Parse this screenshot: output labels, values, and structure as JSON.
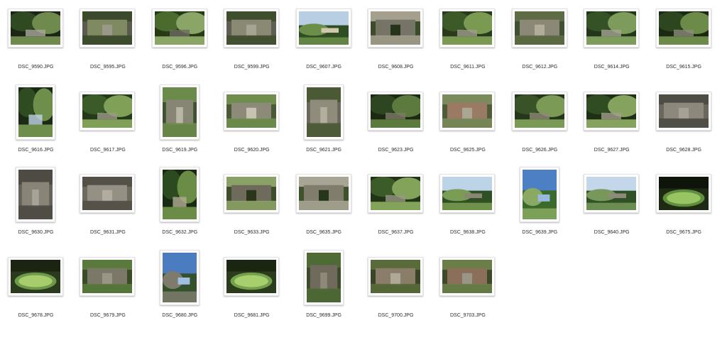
{
  "files": [
    {
      "name": "DSC_9590.JPG",
      "orientation": "landscape",
      "scene": "forest",
      "palette": [
        "#2f4a22",
        "#6e8a4c",
        "#a9a79b",
        "#1c2616"
      ]
    },
    {
      "name": "DSC_9595.JPG",
      "orientation": "landscape",
      "scene": "ruins",
      "palette": [
        "#5a5a50",
        "#7f8a63",
        "#3b4a2a",
        "#9a9888"
      ]
    },
    {
      "name": "DSC_9596.JPG",
      "orientation": "landscape",
      "scene": "forest",
      "palette": [
        "#4a6a2e",
        "#8aa565",
        "#6d6a62",
        "#263a16"
      ]
    },
    {
      "name": "DSC_9599.JPG",
      "orientation": "landscape",
      "scene": "ruins",
      "palette": [
        "#5f5e55",
        "#8a8a74",
        "#3f4e2c",
        "#a7a393"
      ]
    },
    {
      "name": "DSC_9607.JPG",
      "orientation": "landscape",
      "scene": "sky",
      "palette": [
        "#2e4d22",
        "#6b8f49",
        "#b8cfe3",
        "#d0c7ad"
      ]
    },
    {
      "name": "DSC_9608.JPG",
      "orientation": "landscape",
      "scene": "ruins",
      "palette": [
        "#3b4c2b",
        "#767466",
        "#a59f8e",
        "#263519"
      ]
    },
    {
      "name": "DSC_9611.JPG",
      "orientation": "landscape",
      "scene": "forest",
      "palette": [
        "#3c5a28",
        "#7a9a52",
        "#9f9c8c",
        "#2a3a1a"
      ]
    },
    {
      "name": "DSC_9612.JPG",
      "orientation": "landscape",
      "scene": "ruins",
      "palette": [
        "#3f5130",
        "#8b8878",
        "#5e6b45",
        "#b2ad9a"
      ]
    },
    {
      "name": "DSC_9614.JPG",
      "orientation": "landscape",
      "scene": "forest",
      "palette": [
        "#355226",
        "#7d9b5b",
        "#a5a496",
        "#24361a"
      ]
    },
    {
      "name": "DSC_9615.JPG",
      "orientation": "landscape",
      "scene": "forest",
      "palette": [
        "#2e4620",
        "#6c8a48",
        "#8c8a7c",
        "#1b2812"
      ]
    },
    {
      "name": "DSC_9616.JPG",
      "orientation": "portrait",
      "scene": "forest",
      "palette": [
        "#2f4b22",
        "#6d8f4b",
        "#c3d6e6",
        "#1b2a14"
      ]
    },
    {
      "name": "DSC_9617.JPG",
      "orientation": "landscape",
      "scene": "forest",
      "palette": [
        "#3a5a28",
        "#7fa056",
        "#9d9a88",
        "#25381a"
      ]
    },
    {
      "name": "DSC_9619.JPG",
      "orientation": "portrait",
      "scene": "ruins",
      "palette": [
        "#3d5230",
        "#878573",
        "#6b8b4a",
        "#b9b6a6"
      ]
    },
    {
      "name": "DSC_9620.JPG",
      "orientation": "landscape",
      "scene": "ruins",
      "palette": [
        "#4a5a36",
        "#8c8a78",
        "#6f8e4d",
        "#c8c3b0"
      ]
    },
    {
      "name": "DSC_9621.JPG",
      "orientation": "portrait",
      "scene": "ruins",
      "palette": [
        "#6a675c",
        "#8f8c7c",
        "#4b5a34",
        "#b3ae9d"
      ]
    },
    {
      "name": "DSC_9623.JPG",
      "orientation": "landscape",
      "scene": "forest",
      "palette": [
        "#2d4520",
        "#5c7a3d",
        "#807b68",
        "#1c2a13"
      ]
    },
    {
      "name": "DSC_9625.JPG",
      "orientation": "landscape",
      "scene": "ruins",
      "palette": [
        "#4e5d38",
        "#9a7a62",
        "#7a8a5a",
        "#a9a694"
      ]
    },
    {
      "name": "DSC_9626.JPG",
      "orientation": "landscape",
      "scene": "forest",
      "palette": [
        "#3a5228",
        "#7a9a55",
        "#8f8a76",
        "#25361a"
      ]
    },
    {
      "name": "DSC_9627.JPG",
      "orientation": "landscape",
      "scene": "forest",
      "palette": [
        "#2f4c22",
        "#85a35e",
        "#a39e8c",
        "#1f2f15"
      ]
    },
    {
      "name": "DSC_9628.JPG",
      "orientation": "landscape",
      "scene": "ruins",
      "palette": [
        "#6b675e",
        "#8c887c",
        "#4e4d45",
        "#a6a196"
      ]
    },
    {
      "name": "DSC_9630.JPG",
      "orientation": "portrait",
      "scene": "ruins",
      "palette": [
        "#65625a",
        "#888478",
        "#4d4b44",
        "#a7a398"
      ]
    },
    {
      "name": "DSC_9631.JPG",
      "orientation": "landscape",
      "scene": "ruins",
      "palette": [
        "#6e6a60",
        "#949083",
        "#535048",
        "#b1ac9f"
      ]
    },
    {
      "name": "DSC_9632.JPG",
      "orientation": "portrait",
      "scene": "forest",
      "palette": [
        "#2c4a20",
        "#6a8c47",
        "#b3ad92",
        "#1a2a12"
      ]
    },
    {
      "name": "DSC_9633.JPG",
      "orientation": "landscape",
      "scene": "ruins",
      "palette": [
        "#3c4e2a",
        "#6f6b5c",
        "#8ba266",
        "#2a3519"
      ]
    },
    {
      "name": "DSC_9635.JPG",
      "orientation": "landscape",
      "scene": "ruins",
      "palette": [
        "#3d542a",
        "#817d6d",
        "#a9a594",
        "#26361a"
      ]
    },
    {
      "name": "DSC_9637.JPG",
      "orientation": "landscape",
      "scene": "forest",
      "palette": [
        "#3b5b28",
        "#83a35a",
        "#9a9684",
        "#223416"
      ]
    },
    {
      "name": "DSC_9638.JPG",
      "orientation": "landscape",
      "scene": "sky",
      "palette": [
        "#2f5024",
        "#7a9c54",
        "#bcd3e8",
        "#8a8676"
      ]
    },
    {
      "name": "DSC_9639.JPG",
      "orientation": "portrait",
      "scene": "sky",
      "palette": [
        "#3a6b2c",
        "#8aa962",
        "#4d7fc4",
        "#9ab8de"
      ]
    },
    {
      "name": "DSC_9640.JPG",
      "orientation": "landscape",
      "scene": "sky",
      "palette": [
        "#2f5125",
        "#77985a",
        "#c4d7ea",
        "#8f8b7c"
      ]
    },
    {
      "name": "DSC_9675.JPG",
      "orientation": "landscape",
      "scene": "pool",
      "palette": [
        "#1e2a14",
        "#5f8f3e",
        "#98c462",
        "#0f140a"
      ]
    },
    {
      "name": "DSC_9678.JPG",
      "orientation": "landscape",
      "scene": "pool",
      "palette": [
        "#2a3a1c",
        "#6c9a48",
        "#a6cc6c",
        "#1a2410"
      ]
    },
    {
      "name": "DSC_9679.JPG",
      "orientation": "landscape",
      "scene": "ruins",
      "palette": [
        "#3a4c26",
        "#7b7868",
        "#5a7a3c",
        "#9a9686"
      ]
    },
    {
      "name": "DSC_9680.JPG",
      "orientation": "portrait",
      "scene": "sky",
      "palette": [
        "#33512a",
        "#7e7b6c",
        "#4b7cc0",
        "#a1bee0"
      ]
    },
    {
      "name": "DSC_9681.JPG",
      "orientation": "landscape",
      "scene": "pool",
      "palette": [
        "#2b3c1c",
        "#74a04c",
        "#a8cf6e",
        "#1b2611"
      ]
    },
    {
      "name": "DSC_9699.JPG",
      "orientation": "portrait",
      "scene": "ruins",
      "palette": [
        "#3b4a2a",
        "#6f6a5c",
        "#4f6a34",
        "#8f897a"
      ]
    },
    {
      "name": "DSC_9700.JPG",
      "orientation": "landscape",
      "scene": "ruins",
      "palette": [
        "#3a4426",
        "#8a7d6a",
        "#5a6b3a",
        "#b0a896"
      ]
    },
    {
      "name": "DSC_9703.JPG",
      "orientation": "landscape",
      "scene": "ruins",
      "palette": [
        "#3c4a2a",
        "#8b6f5b",
        "#6a7f48",
        "#9a9585"
      ]
    }
  ]
}
